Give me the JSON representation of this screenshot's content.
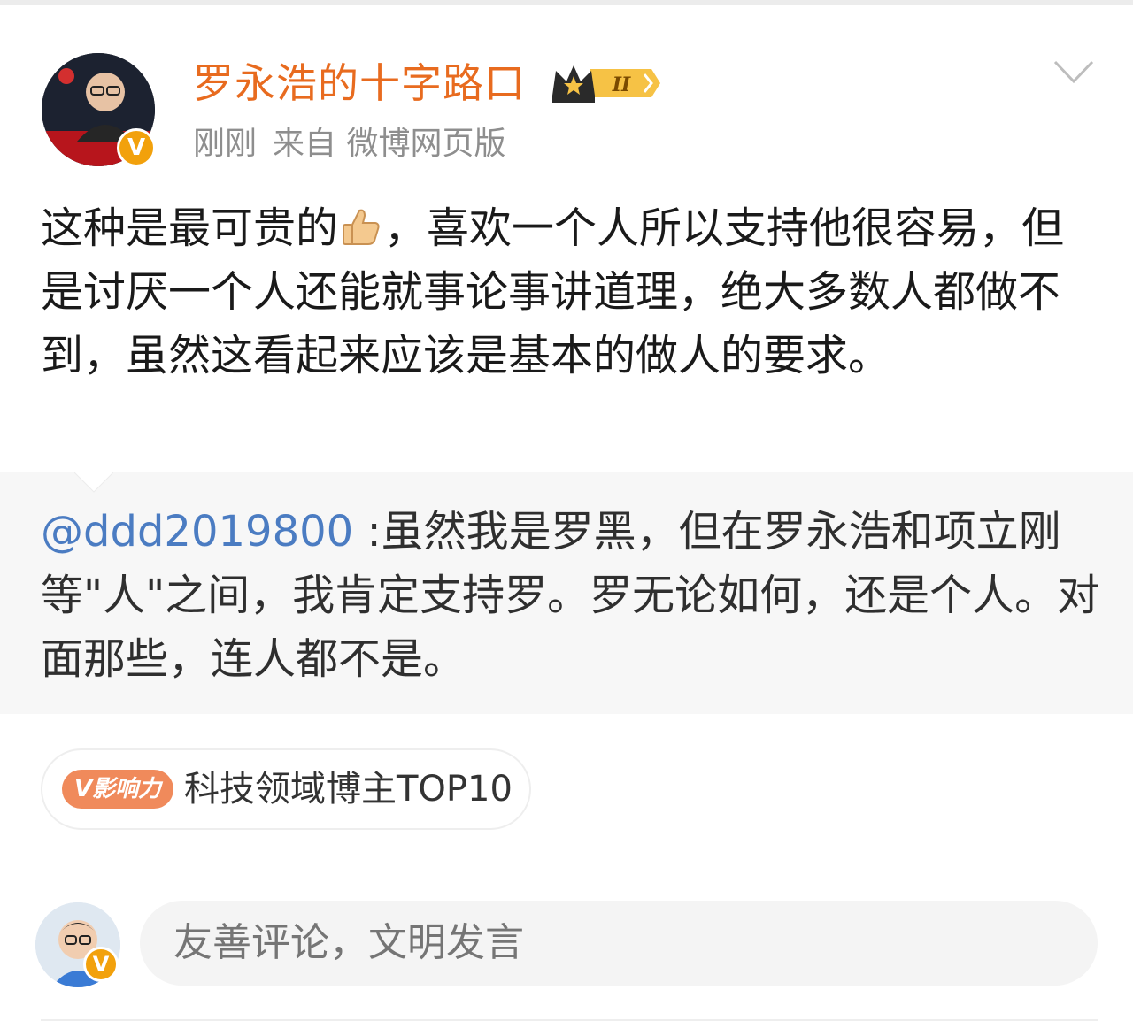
{
  "post": {
    "username": "罗永浩的十字路口",
    "level_badge": "II",
    "verified_mark": "V",
    "time": "刚刚",
    "source": "来自 微博网页版",
    "text_before_emoji": "这种是最可贵的",
    "emoji": "thumbs-up-icon",
    "text_after_emoji": "，喜欢一个人所以支持他很容易，但是讨厌一个人还能就事论事讲道理，绝大多数人都做不到，虽然这看起来应该是基本的做人的要求。",
    "avatar_caption": "罗永浩的十字路口"
  },
  "quote": {
    "mention": "@ddd2019800",
    "text": " :虽然我是罗黑，但在罗永浩和项立刚等\"人\"之间，我肯定支持罗。罗无论如何，还是个人。对面那些，连人都不是。"
  },
  "influence": {
    "badge_label": "V影响力",
    "text": "科技领域博主TOP10"
  },
  "comment": {
    "placeholder": "友善评论，文明发言",
    "verified_mark": "V"
  },
  "colors": {
    "username": "#e86b1f",
    "mention": "#4b7cc2",
    "verified": "#f2a10c",
    "influence_badge": "#f08a5b"
  }
}
